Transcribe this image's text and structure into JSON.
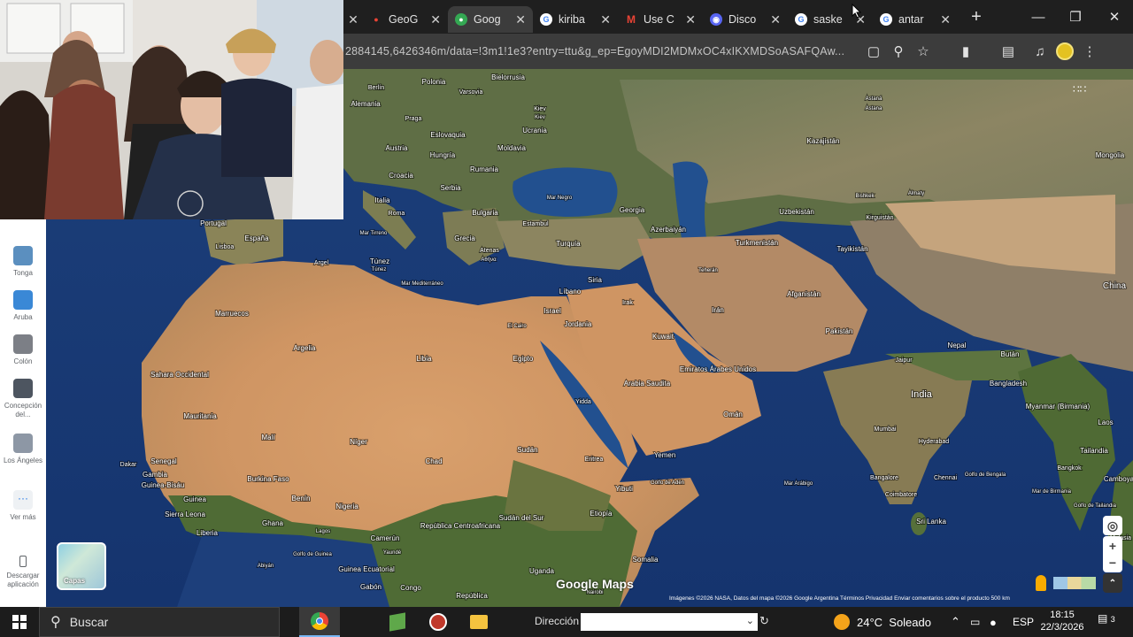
{
  "browser": {
    "tabs": [
      {
        "title": "GeoG",
        "icon": "maps-pin-icon",
        "active": false
      },
      {
        "title": "Goog",
        "icon": "google-maps-icon",
        "active": true
      },
      {
        "title": "kiriba",
        "icon": "google-g-icon",
        "active": false
      },
      {
        "title": "Use C",
        "icon": "gmail-icon",
        "active": false
      },
      {
        "title": "Disco",
        "icon": "discord-icon",
        "active": false
      },
      {
        "title": "saske",
        "icon": "google-g-icon",
        "active": false
      },
      {
        "title": "antar",
        "icon": "google-g-icon",
        "active": false
      }
    ],
    "close_glyph": "✕",
    "new_tab_glyph": "+",
    "url": "2884145,6426346m/data=!3m1!1e3?entry=ttu&g_ep=EgoyMDI2MDMxOC4xIKXMDSoASAFQAw..."
  },
  "map": {
    "countries": [
      {
        "label": "Polonia"
      },
      {
        "label": "Bielorrusia"
      },
      {
        "label": "Berlín"
      },
      {
        "label": "Varsovia"
      },
      {
        "label": "Alemania"
      },
      {
        "label": "Praga"
      },
      {
        "label": "Kiev"
      },
      {
        "label": "Kiev"
      },
      {
        "label": "Eslovaquia"
      },
      {
        "label": "Ucrania"
      },
      {
        "label": "Austria"
      },
      {
        "label": "Hungría"
      },
      {
        "label": "Moldavia"
      },
      {
        "label": "Croacia"
      },
      {
        "label": "Rumania"
      },
      {
        "label": "Serbia"
      },
      {
        "label": "Italia"
      },
      {
        "label": "Bulgaria"
      },
      {
        "label": "Roma"
      },
      {
        "label": "Mar Negro"
      },
      {
        "label": "Georgia"
      },
      {
        "label": "Estambul"
      },
      {
        "label": "Azerbaiyán"
      },
      {
        "label": "Mar Tirreno"
      },
      {
        "label": "Grecia"
      },
      {
        "label": "Turquía"
      },
      {
        "label": "Atenas"
      },
      {
        "label": "Αθήνα"
      },
      {
        "label": "Portugal"
      },
      {
        "label": "Lisboa"
      },
      {
        "label": "España"
      },
      {
        "label": "Argel"
      },
      {
        "label": "Túnez"
      },
      {
        "label": "Túnez"
      },
      {
        "label": "Mar Mediterráneo"
      },
      {
        "label": "Marruecos"
      },
      {
        "label": "Argelia"
      },
      {
        "label": "Libia"
      },
      {
        "label": "Egipto"
      },
      {
        "label": "El Cairo"
      },
      {
        "label": "Líbano"
      },
      {
        "label": "Siria"
      },
      {
        "label": "Irak"
      },
      {
        "label": "Israel"
      },
      {
        "label": "Jordania"
      },
      {
        "label": "Kuwait"
      },
      {
        "label": "Irán"
      },
      {
        "label": "Teherán"
      },
      {
        "label": "Turkmenistán"
      },
      {
        "label": "Uzbekistán"
      },
      {
        "label": "Kazajistán"
      },
      {
        "label": "Astaná"
      },
      {
        "label": "Astana"
      },
      {
        "label": "Bishkek"
      },
      {
        "label": "Almaty"
      },
      {
        "label": "Kirguistán"
      },
      {
        "label": "Tayikistán"
      },
      {
        "label": "Afganistán"
      },
      {
        "label": "Pakistán"
      },
      {
        "label": "Mongolia"
      },
      {
        "label": "China"
      },
      {
        "label": "Sahara Occidental"
      },
      {
        "label": "Mauritania"
      },
      {
        "label": "Malí"
      },
      {
        "label": "Níger"
      },
      {
        "label": "Chad"
      },
      {
        "label": "Sudán"
      },
      {
        "label": "Eritrea"
      },
      {
        "label": "Yidda"
      },
      {
        "label": "Arabia Saudita"
      },
      {
        "label": "Emiratos Árabes Unidos"
      },
      {
        "label": "Omán"
      },
      {
        "label": "Yemen"
      },
      {
        "label": "Golfo de Adén"
      },
      {
        "label": "Yibuti"
      },
      {
        "label": "Etiopía"
      },
      {
        "label": "Sudán del Sur"
      },
      {
        "label": "República Centroafricana"
      },
      {
        "label": "Camerún"
      },
      {
        "label": "Nigeria"
      },
      {
        "label": "Benín"
      },
      {
        "label": "Ghana"
      },
      {
        "label": "Burkina Faso"
      },
      {
        "label": "Lagos"
      },
      {
        "label": "Abiyán"
      },
      {
        "label": "Liberia"
      },
      {
        "label": "Sierra Leona"
      },
      {
        "label": "Guinea"
      },
      {
        "label": "Guinea-Bisáu"
      },
      {
        "label": "Gambia"
      },
      {
        "label": "Senegal"
      },
      {
        "label": "Dakar"
      },
      {
        "label": "Golfo de Guinea"
      },
      {
        "label": "Guinea Ecuatorial"
      },
      {
        "label": "Yaundé"
      },
      {
        "label": "Gabón"
      },
      {
        "label": "Congo"
      },
      {
        "label": "República"
      },
      {
        "label": "Uganda"
      },
      {
        "label": "Somalia"
      },
      {
        "label": "Nairobi"
      },
      {
        "label": "India"
      },
      {
        "label": "Nepal"
      },
      {
        "label": "Bután"
      },
      {
        "label": "Bangladesh"
      },
      {
        "label": "Jaipur"
      },
      {
        "label": "Mumbai"
      },
      {
        "label": "Hyderabad"
      },
      {
        "label": "Bangalore"
      },
      {
        "label": "Chennai"
      },
      {
        "label": "Coimbatore"
      },
      {
        "label": "Sri Lanka"
      },
      {
        "label": "Mar Arábigo"
      },
      {
        "label": "Golfo de Bengala"
      },
      {
        "label": "Myanmar (Birmania)"
      },
      {
        "label": "Laos"
      },
      {
        "label": "Tailandia"
      },
      {
        "label": "Bangkok"
      },
      {
        "label": "Mar de Birmania"
      },
      {
        "label": "Golfo de Tailandia"
      },
      {
        "label": "Camboya"
      },
      {
        "label": "Malasia"
      }
    ]
  },
  "sidebar": {
    "items": [
      {
        "label": "Tonga",
        "color": "#5b8fbf"
      },
      {
        "label": "Aruba",
        "color": "#3a88d6"
      },
      {
        "label": "Colón",
        "color": "#7c7f86"
      },
      {
        "label": "Concepción del...",
        "color": "#4d5560"
      },
      {
        "label": "Los Ángeles",
        "color": "#8d97a5"
      },
      {
        "label": "Ver más",
        "color": "#eef1f4"
      }
    ],
    "download_label": "Descargar aplicación",
    "capas_label": "Capas"
  },
  "map_footer": {
    "google_logo": "Google Maps",
    "attribution": "Imágenes ©2026 NASA, Datos del mapa ©2026 Google   Argentina   Términos   Privacidad   Enviar comentarios sobre el producto   500 km"
  },
  "taskbar": {
    "search_label": "Buscar",
    "direccion_label": "Dirección",
    "weather": "24°C  Soleado",
    "language": "ESP",
    "time": "18:15",
    "date": "22/3/2026",
    "notification_count": "3"
  }
}
